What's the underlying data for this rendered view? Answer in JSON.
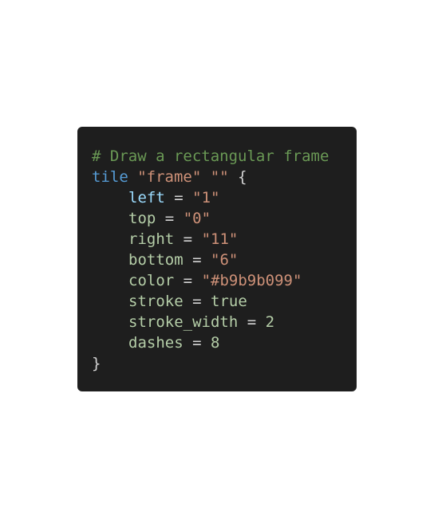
{
  "code": {
    "comment": "# Draw a rectangular frame",
    "keyword": "tile",
    "tile_name": "\"frame\"",
    "tile_label": "\"\"",
    "open_brace": "{",
    "close_brace": "}",
    "lines": [
      {
        "key": "left",
        "value": "\"1\""
      },
      {
        "key": "top",
        "value": "\"0\""
      },
      {
        "key": "right",
        "value": "\"11\""
      },
      {
        "key": "bottom",
        "value": "\"6\""
      },
      {
        "key": "color",
        "value": "\"#b9b9b099\""
      },
      {
        "key": "stroke",
        "value": "true"
      },
      {
        "key": "stroke_width",
        "value": "2"
      },
      {
        "key": "dashes",
        "value": "8"
      }
    ],
    "equals": "="
  },
  "colors": {
    "background": "#1e1e1e",
    "comment": "#6a9955",
    "keyword": "#569cd6",
    "string": "#ce9178",
    "identifier": "#9cdcfe",
    "property": "#b5cea8",
    "text": "#d4d4d4"
  }
}
